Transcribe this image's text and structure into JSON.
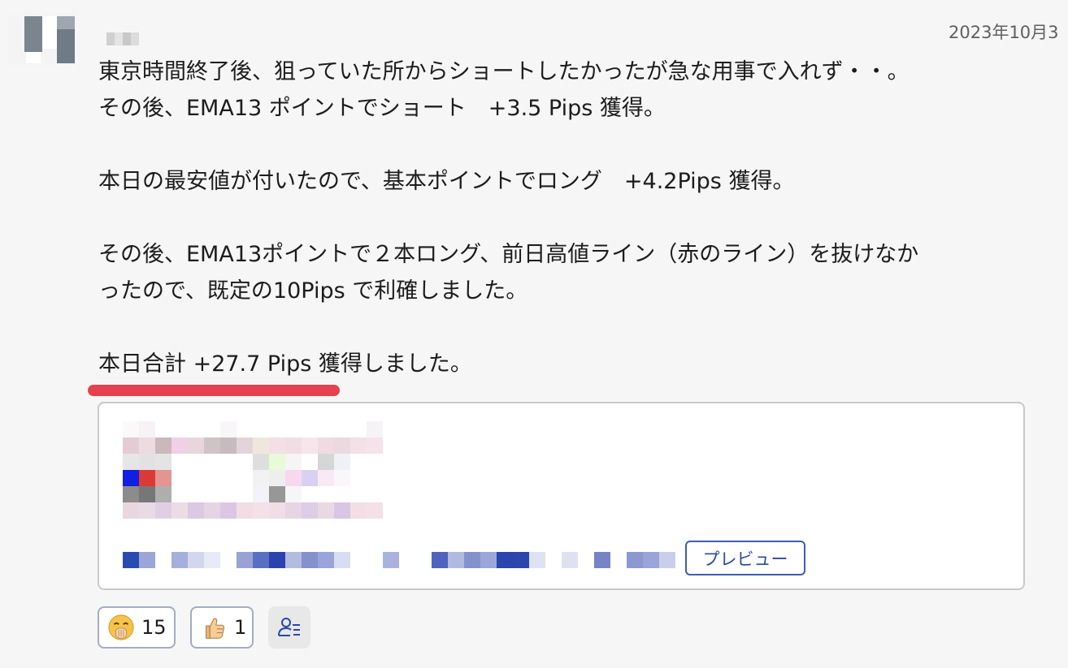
{
  "message": {
    "timestamp": "2023年10月3",
    "lines": [
      "東京時間終了後、狙っていた所からショートしたかったが急な用事で入れず・・。",
      "その後、EMA13 ポイントでショート　+3.5 Pips 獲得。",
      "本日の最安値が付いたので、基本ポイントでロング　+4.2Pips 獲得。",
      "その後、EMA13ポイントで２本ロング、前日高値ライン（赤のライン）を抜けなか",
      "ったので、既定の10Pips で利確しました。",
      "本日合計 +27.7 Pips 獲得しました。"
    ]
  },
  "link_preview": {
    "preview_button_label": "プレビュー"
  },
  "reactions": [
    {
      "emoji": "face-with-hand-over-mouth",
      "count": "15"
    },
    {
      "emoji": "thumbs-up",
      "count": "1"
    }
  ],
  "colors": {
    "accent_underline": "#e5414f",
    "preview_button": "#2d47a6",
    "reaction_border": "#a4acc0"
  }
}
